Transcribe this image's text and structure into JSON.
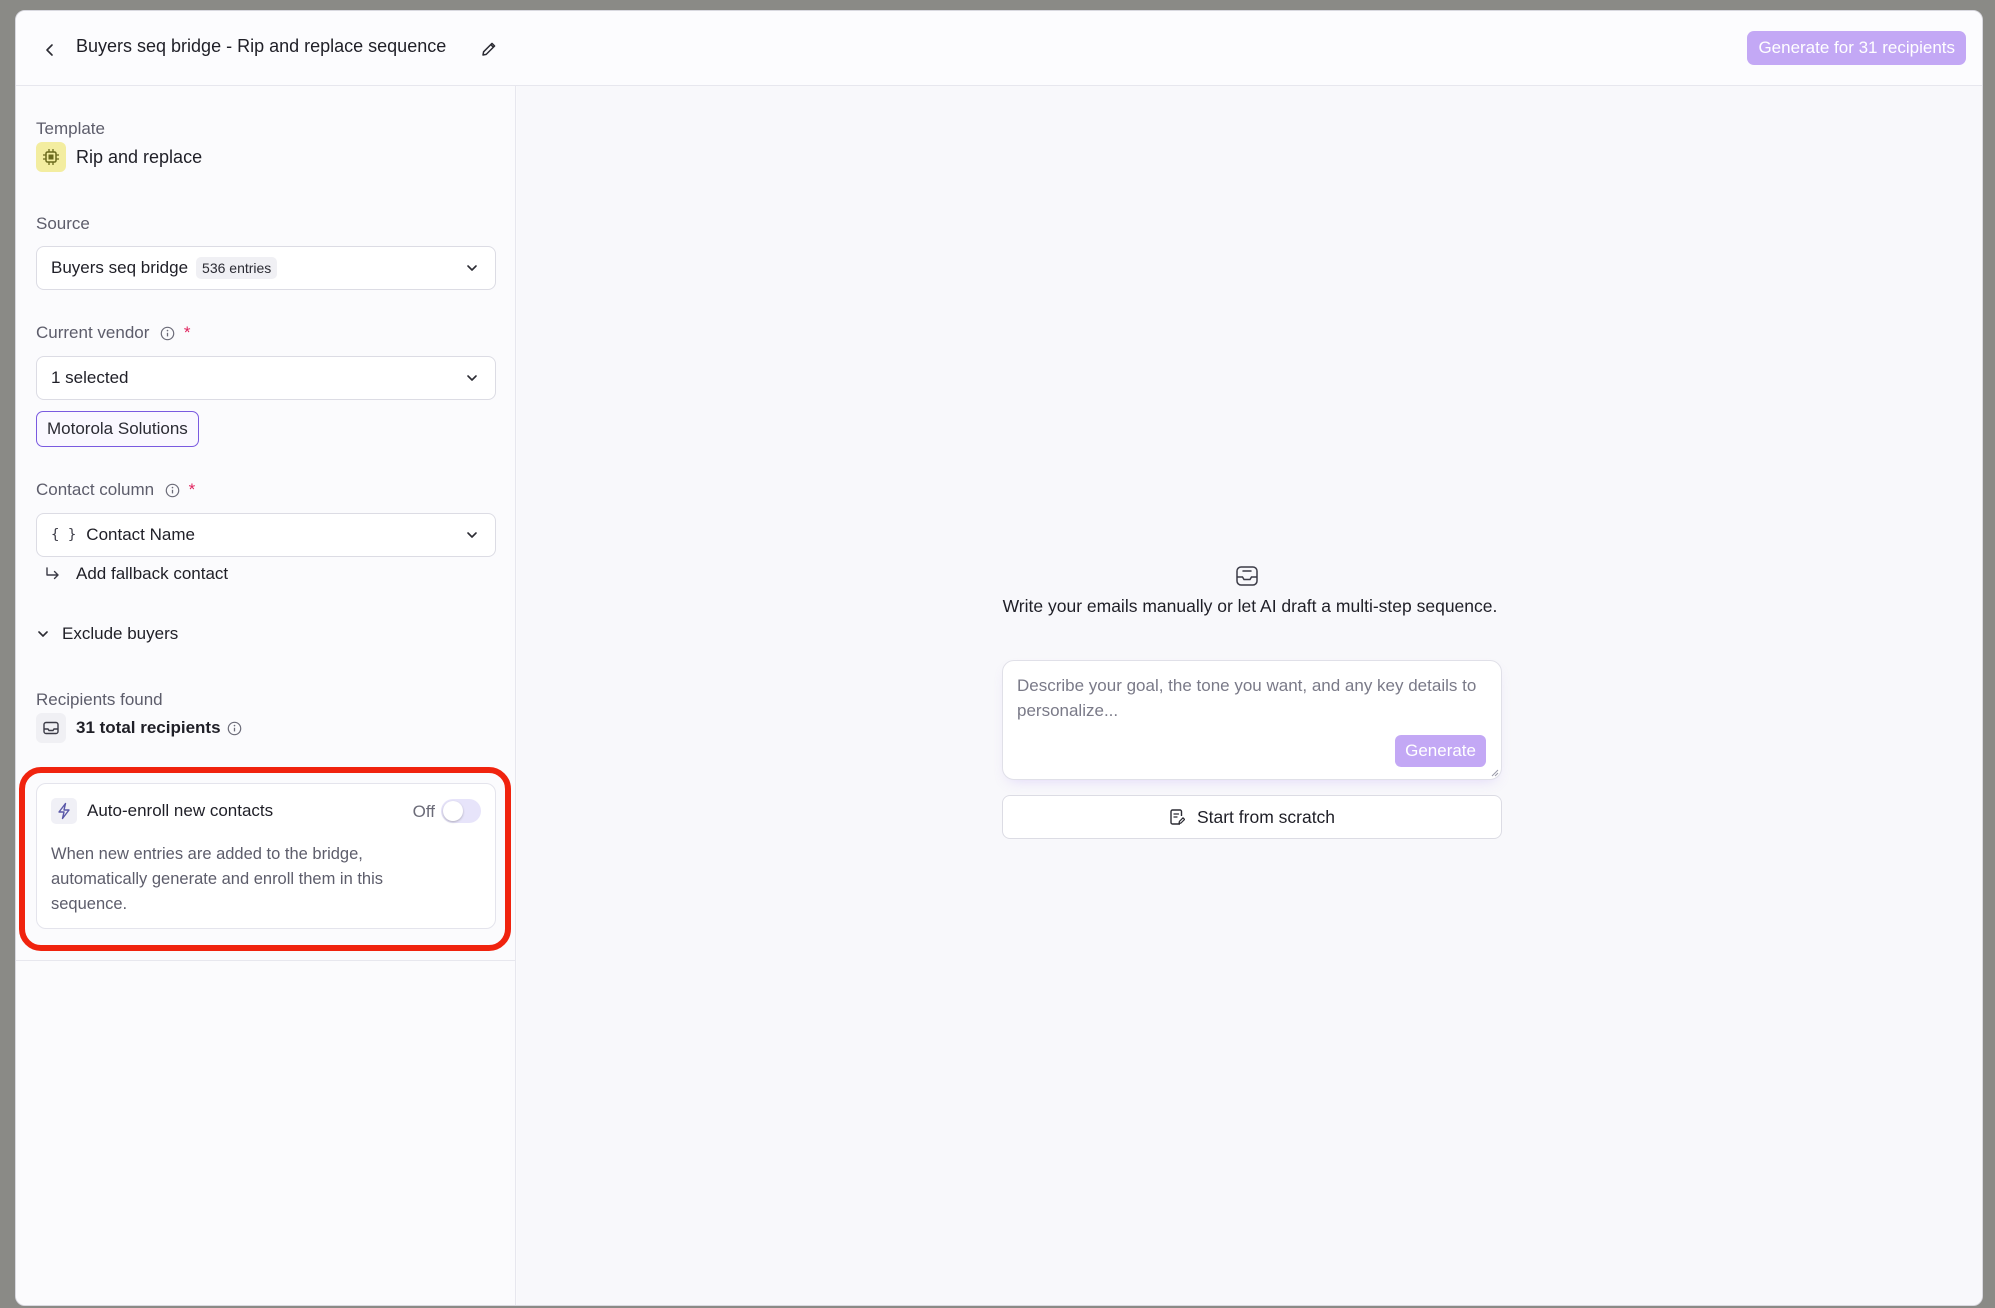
{
  "header": {
    "title": "Buyers seq bridge - Rip and replace sequence",
    "generate_all_label": "Generate for 31 recipients",
    "accent_color": "#c3a8f5"
  },
  "sidebar": {
    "template": {
      "label": "Template",
      "name": "Rip and replace",
      "icon": "chip-icon"
    },
    "source": {
      "label": "Source",
      "value": "Buyers seq bridge",
      "badge": "536 entries"
    },
    "current_vendor": {
      "label": "Current vendor",
      "required_mark": "*",
      "value": "1 selected",
      "chips": [
        "Motorola Solutions"
      ]
    },
    "contact_column": {
      "label": "Contact column",
      "required_mark": "*",
      "value": "Contact Name"
    },
    "fallback_label": "Add fallback contact",
    "exclude_label": "Exclude buyers",
    "recipients": {
      "label": "Recipients found",
      "value": "31 total recipients"
    },
    "auto_enroll": {
      "title": "Auto-enroll new contacts",
      "state_label": "Off",
      "enabled": false,
      "description": "When new entries are added to the bridge, automatically generate and enroll them in this sequence."
    }
  },
  "main": {
    "empty_text": "Write your emails manually or let AI draft a multi-step sequence.",
    "prompt_placeholder": "Describe your goal, the tone you want, and any key details to personalize...",
    "generate_label": "Generate",
    "scratch_label": "Start from scratch"
  }
}
